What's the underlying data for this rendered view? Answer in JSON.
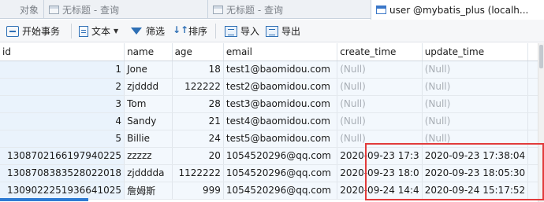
{
  "tabs": [
    {
      "label": "对象",
      "active": false
    },
    {
      "label": "无标题 - 查询",
      "active": false
    },
    {
      "label": "无标题 - 查询",
      "active": false
    },
    {
      "label": "user @mybatis_plus (localh...",
      "active": true
    }
  ],
  "toolbar": {
    "begin_transaction": "开始事务",
    "text": "文本",
    "filter": "筛选",
    "sort": "排序",
    "import": "导入",
    "export": "导出"
  },
  "table": {
    "columns": [
      "id",
      "name",
      "age",
      "email",
      "create_time",
      "update_time",
      ""
    ],
    "rows": [
      [
        "1",
        "Jone",
        "18",
        "test1@baomidou.com",
        "(Null)",
        "(Null)",
        ""
      ],
      [
        "2",
        "zjdddd",
        "122222",
        "test2@baomidou.com",
        "(Null)",
        "(Null)",
        ""
      ],
      [
        "3",
        "Tom",
        "28",
        "test3@baomidou.com",
        "(Null)",
        "(Null)",
        ""
      ],
      [
        "4",
        "Sandy",
        "21",
        "test4@baomidou.com",
        "(Null)",
        "(Null)",
        ""
      ],
      [
        "5",
        "Billie",
        "24",
        "test5@baomidou.com",
        "(Null)",
        "(Null)",
        ""
      ],
      [
        "1308702166197940225",
        "zzzzz",
        "20",
        "1054520296@qq.com",
        "2020-09-23 17:3",
        "2020-09-23 17:38:04",
        ""
      ],
      [
        "1308708383528022018",
        "zjdddda",
        "1122222",
        "1054520296@qq.com",
        "2020-09-23 18:0",
        "2020-09-23 18:05:30",
        ""
      ],
      [
        "1309022251936641025",
        "詹姆斯",
        "999",
        "1054520296@qq.com",
        "2020-09-24 14:4",
        "2020-09-24 15:17:52",
        ""
      ]
    ]
  },
  "colors": {
    "highlight_box": "#e23b3b",
    "null_text": "#a8aeb5",
    "accent": "#2e7bd3"
  }
}
